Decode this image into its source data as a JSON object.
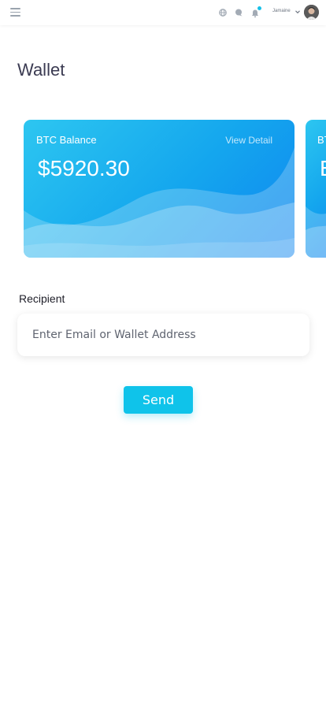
{
  "header": {
    "menu_icon": "hamburger-icon",
    "icons": [
      "globe-icon",
      "chat-icon",
      "bell-icon"
    ],
    "user_name": "Jamaine",
    "accent": "#16c0e8"
  },
  "page": {
    "title": "Wallet"
  },
  "cards": [
    {
      "label": "BTC Balance",
      "link": "View Detail",
      "amount": "$5920.30"
    },
    {
      "label": "BT",
      "amount": "E"
    }
  ],
  "form": {
    "recipient_label": "Recipient",
    "recipient_placeholder": "Enter Email or Wallet Address",
    "recipient_value": "",
    "send_label": "Send"
  }
}
